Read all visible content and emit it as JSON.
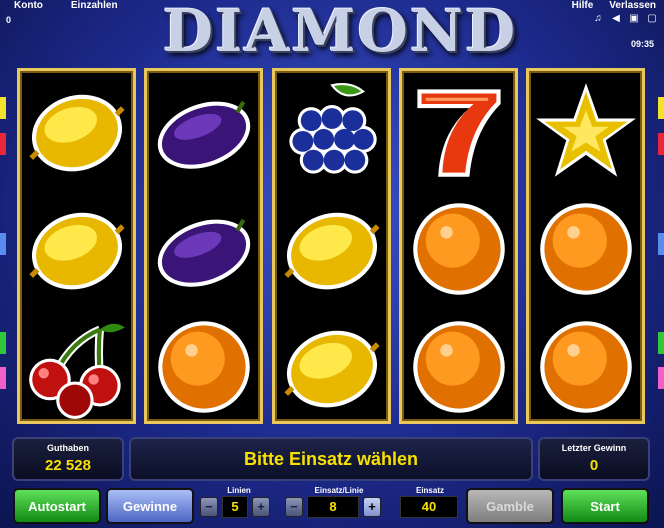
{
  "menu": {
    "konto": "Konto",
    "einzahlen": "Einzahlen",
    "hilfe": "Hilfe",
    "verlassen": "Verlassen"
  },
  "top_balance": "0",
  "clock": "09:35",
  "title": {
    "word": "DIAMOND",
    "seven": "7"
  },
  "side_marker_colors": {
    "yellow": "#f4e22a",
    "red": "#e8283a",
    "blue": "#5a8cf0",
    "green": "#2ec83a",
    "pink": "#f060c8"
  },
  "reels": [
    [
      "lemon",
      "lemon",
      "cherries"
    ],
    [
      "plum",
      "plum",
      "orange"
    ],
    [
      "grapes",
      "lemon",
      "lemon"
    ],
    [
      "seven",
      "orange",
      "orange"
    ],
    [
      "star",
      "orange",
      "orange"
    ]
  ],
  "panels": {
    "guthaben_label": "Guthaben",
    "guthaben_value": "22 528",
    "message": "Bitte Einsatz wählen",
    "letzter_gewinn_label": "Letzter Gewinn",
    "letzter_gewinn_value": "0"
  },
  "controls": {
    "autostart": "Autostart",
    "gewinne": "Gewinne",
    "linien_label": "Linien",
    "linien_value": "5",
    "einsatz_linie_label": "Einsatz/Linie",
    "einsatz_linie_value": "8",
    "einsatz_label": "Einsatz",
    "einsatz_value": "40",
    "gamble": "Gamble",
    "start": "Start",
    "minus": "−",
    "plus": "+"
  }
}
